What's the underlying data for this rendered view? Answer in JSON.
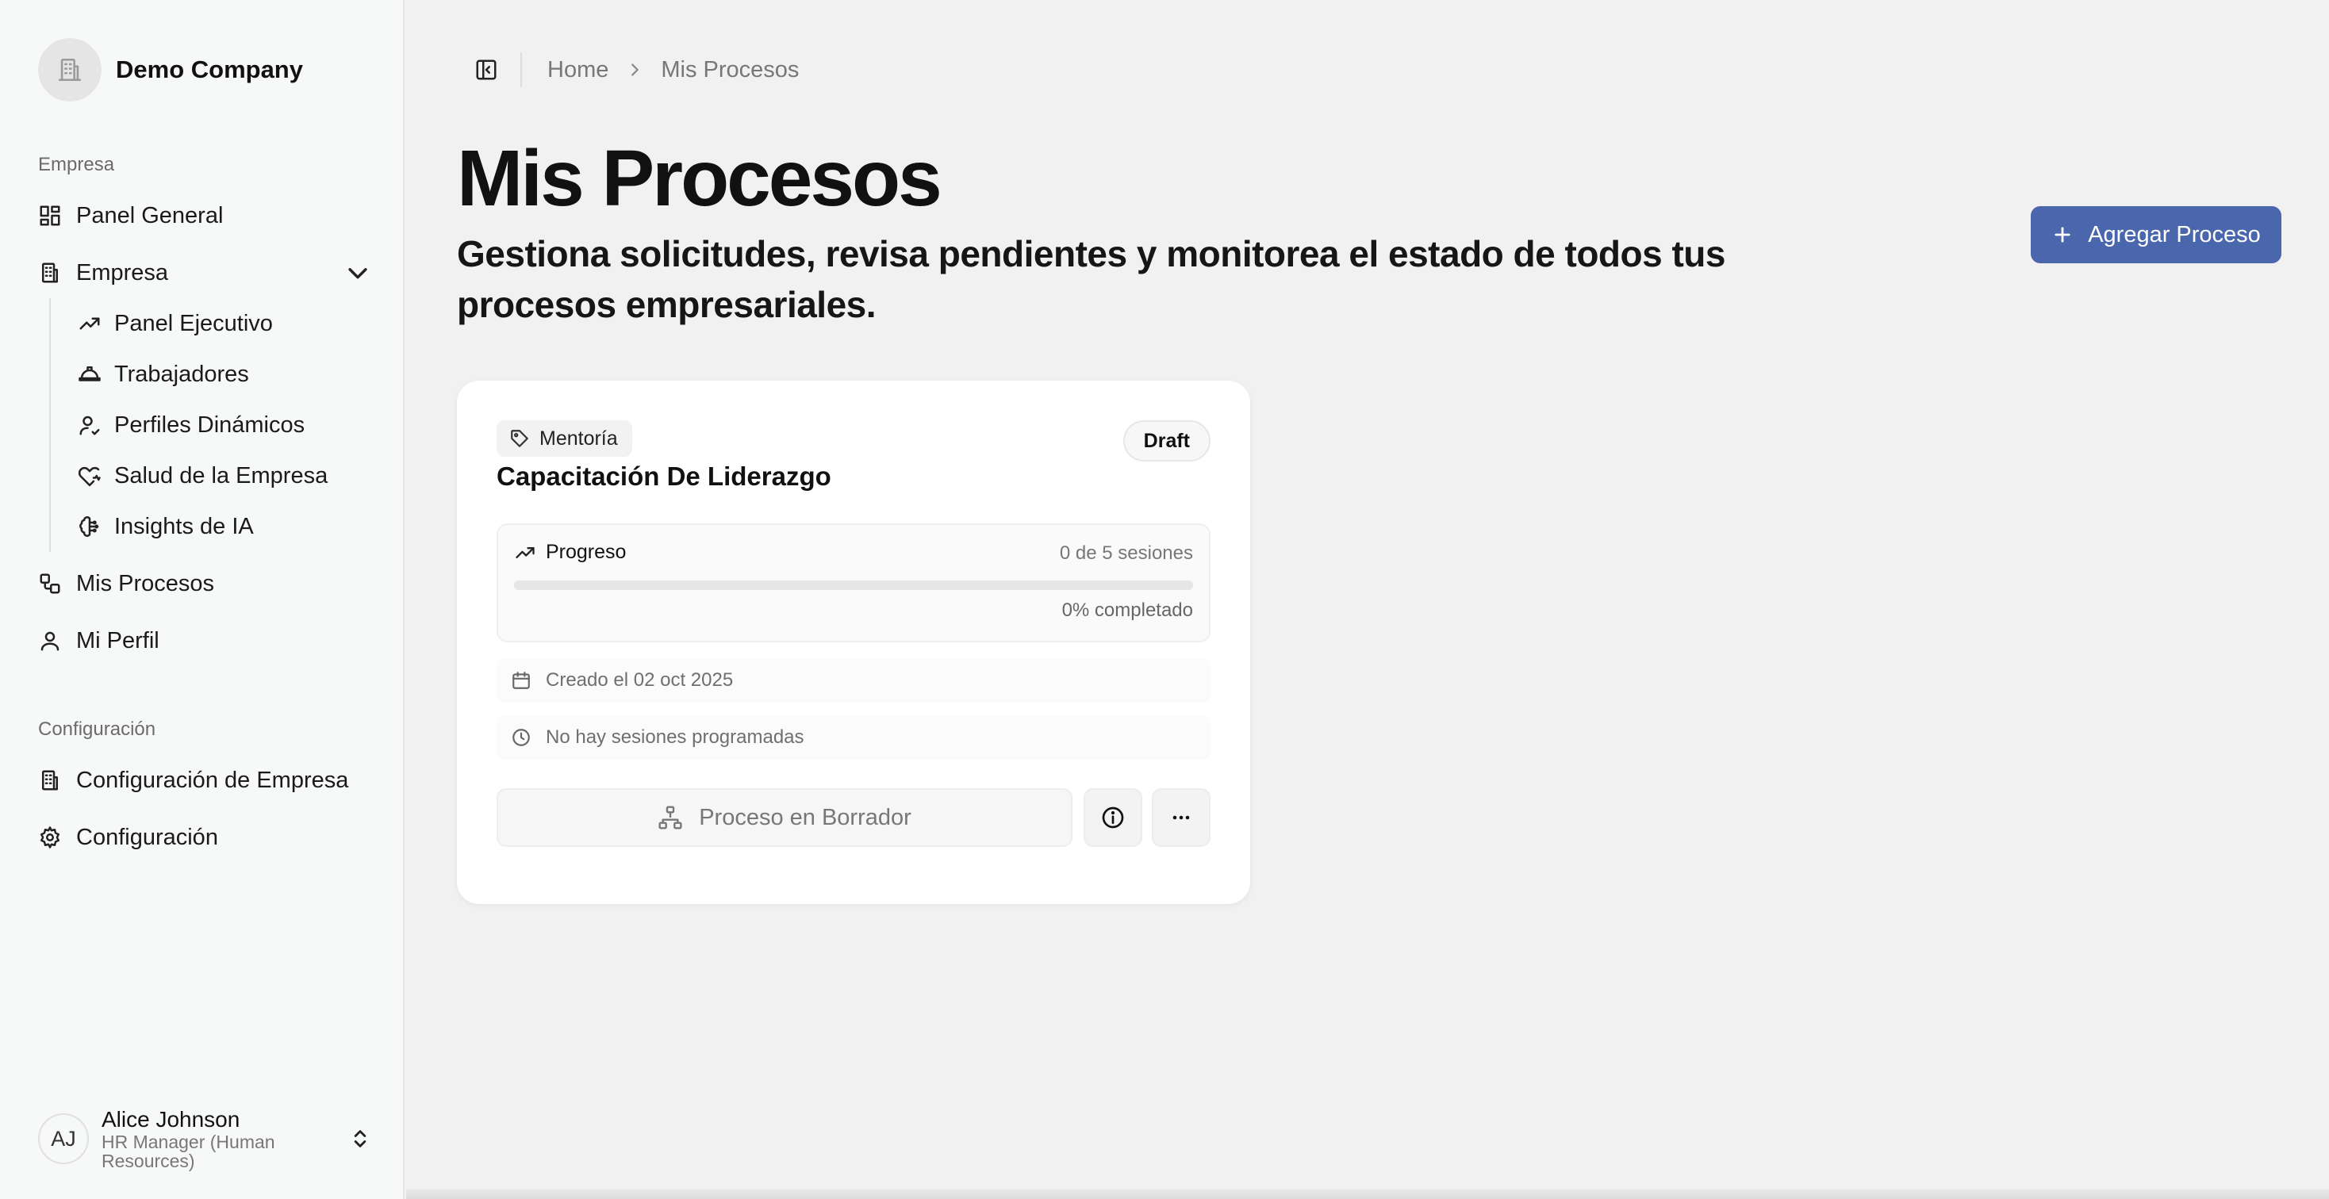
{
  "company": {
    "name": "Demo Company",
    "logo_icon": "building-icon"
  },
  "sidebar": {
    "section_empresa": "Empresa",
    "section_config": "Configuración",
    "items": [
      {
        "label": "Panel General",
        "icon": "dashboard-grid-icon"
      },
      {
        "label": "Empresa",
        "icon": "building-icon",
        "expanded": true
      },
      {
        "label": "Mis Procesos",
        "icon": "workflow-icon"
      },
      {
        "label": "Mi Perfil",
        "icon": "user-icon"
      }
    ],
    "sub_items": [
      {
        "label": "Panel Ejecutivo",
        "icon": "trending-up-icon"
      },
      {
        "label": "Trabajadores",
        "icon": "hard-hat-icon"
      },
      {
        "label": "Perfiles Dinámicos",
        "icon": "user-check-icon"
      },
      {
        "label": "Salud de la Empresa",
        "icon": "heart-pulse-icon"
      },
      {
        "label": "Insights de IA",
        "icon": "brain-icon"
      }
    ],
    "config_items": [
      {
        "label": "Configuración de Empresa",
        "icon": "building-icon"
      },
      {
        "label": "Configuración",
        "icon": "gear-icon"
      }
    ]
  },
  "user": {
    "initials": "AJ",
    "name": "Alice Johnson",
    "role": "HR Manager (Human Resources)"
  },
  "breadcrumb": {
    "home": "Home",
    "current": "Mis Procesos"
  },
  "header": {
    "title": "Mis Procesos",
    "subtitle": "Gestiona solicitudes, revisa pendientes y monitorea el estado de todos tus procesos empresariales.",
    "add_button": "Agregar Proceso"
  },
  "card": {
    "tag": "Mentoría",
    "status": "Draft",
    "title": "Capacitación De Liderazgo",
    "progress_label": "Progreso",
    "progress_count": "0 de 5 sesiones",
    "progress_fraction": 0,
    "progress_pct": "0% completado",
    "created": "Creado el 02 oct 2025",
    "sessions": "No hay sesiones programadas",
    "action_label": "Proceso en Borrador"
  },
  "colors": {
    "accent": "#4a66ad",
    "background": "#f1f1f1",
    "sidebar": "#f7f8f8"
  }
}
